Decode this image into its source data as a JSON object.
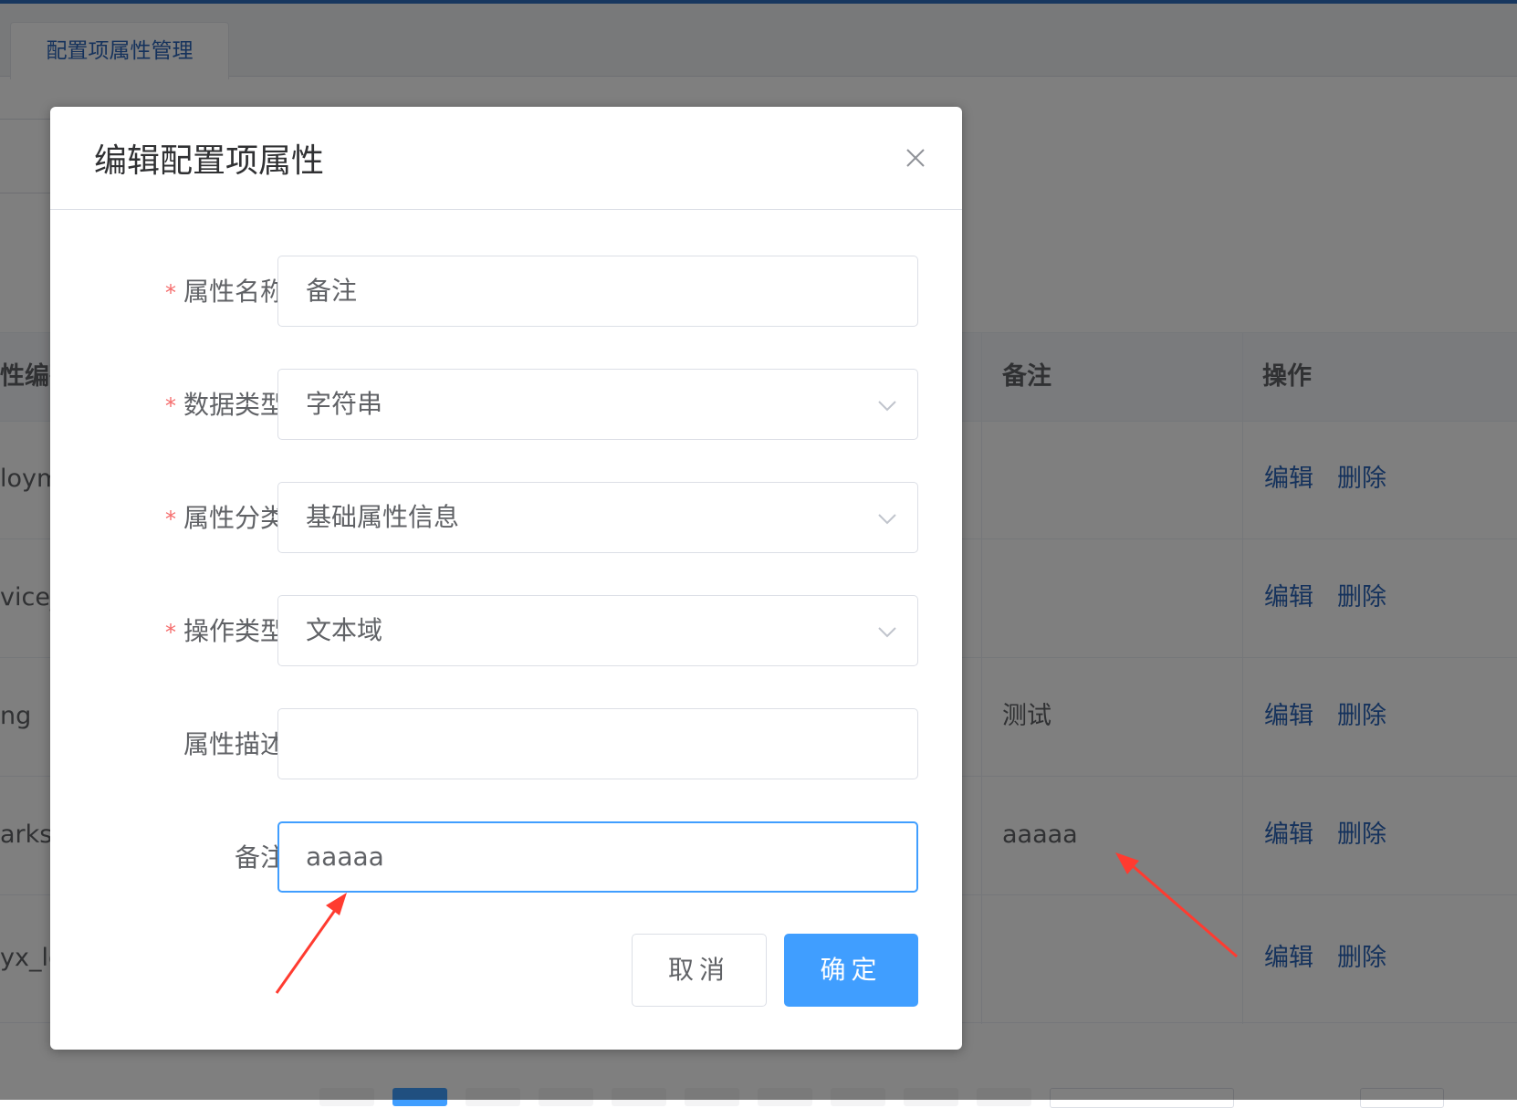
{
  "tab": {
    "label": "配置项属性管理"
  },
  "table": {
    "headers": {
      "code_partial": "性编码",
      "remark": "备注",
      "actions": "操作"
    },
    "rows": [
      {
        "code_partial": "loym",
        "remark": ""
      },
      {
        "code_partial": "vice_",
        "remark": ""
      },
      {
        "code_partial": "ng",
        "remark": "测试"
      },
      {
        "code_partial": "arks",
        "remark": "aaaaa"
      },
      {
        "code_partial": "yx_lo",
        "remark": ""
      }
    ],
    "actions": {
      "edit": "编辑",
      "delete": "删除"
    }
  },
  "dialog": {
    "title": "编辑配置项属性",
    "required_mark": "*",
    "fields": {
      "name": {
        "label": "属性名称",
        "value": "备注"
      },
      "data_type": {
        "label": "数据类型",
        "value": "字符串"
      },
      "category": {
        "label": "属性分类",
        "value": "基础属性信息"
      },
      "op_type": {
        "label": "操作类型",
        "value": "文本域"
      },
      "description": {
        "label": "属性描述",
        "value": ""
      },
      "remark": {
        "label": "备注",
        "value": "aaaaa"
      }
    },
    "cancel_label": "取消",
    "ok_label": "确定"
  },
  "colors": {
    "primary": "#409eff",
    "link": "#2a64b8",
    "required": "#f56c6c",
    "annotation_arrow": "#ff3b30"
  }
}
